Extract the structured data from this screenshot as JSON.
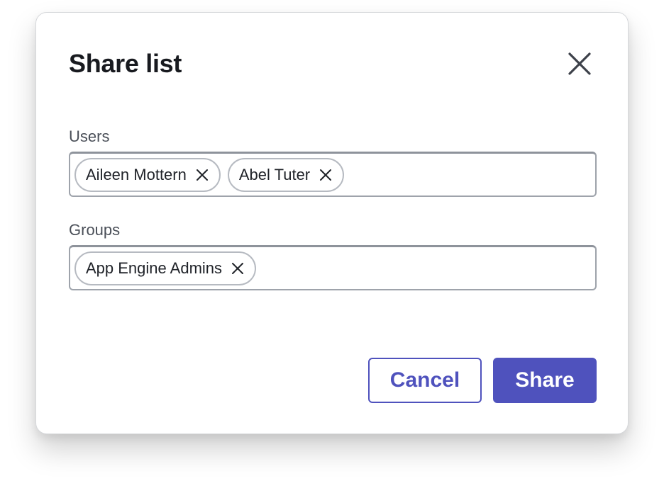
{
  "dialog": {
    "title": "Share list",
    "close_icon": "close-icon"
  },
  "users": {
    "label": "Users",
    "chips": [
      {
        "label": "Aileen Mottern"
      },
      {
        "label": "Abel Tuter"
      }
    ]
  },
  "groups": {
    "label": "Groups",
    "chips": [
      {
        "label": "App Engine Admins"
      }
    ]
  },
  "actions": {
    "cancel_label": "Cancel",
    "share_label": "Share"
  },
  "colors": {
    "accent": "#4f52bd",
    "text": "#181a1f",
    "label": "#4a4f58",
    "border": "#9ea3ab"
  }
}
